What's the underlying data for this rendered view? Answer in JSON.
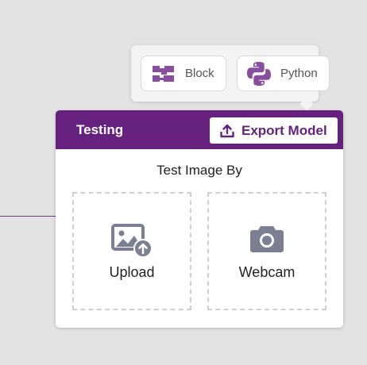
{
  "code_view": {
    "block_label": "Block",
    "python_label": "Python"
  },
  "testing": {
    "title": "Testing",
    "export_label": "Export Model",
    "test_image_by": "Test Image By",
    "upload_label": "Upload",
    "webcam_label": "Webcam"
  },
  "colors": {
    "accent": "#66217e",
    "icon_purple": "#8a4ea0",
    "icon_gray": "#7b7f94"
  },
  "icons": {
    "block": "block-stack-icon",
    "python": "python-logo-icon",
    "export": "upload-tray-icon",
    "upload": "image-upload-icon",
    "webcam": "camera-icon"
  }
}
